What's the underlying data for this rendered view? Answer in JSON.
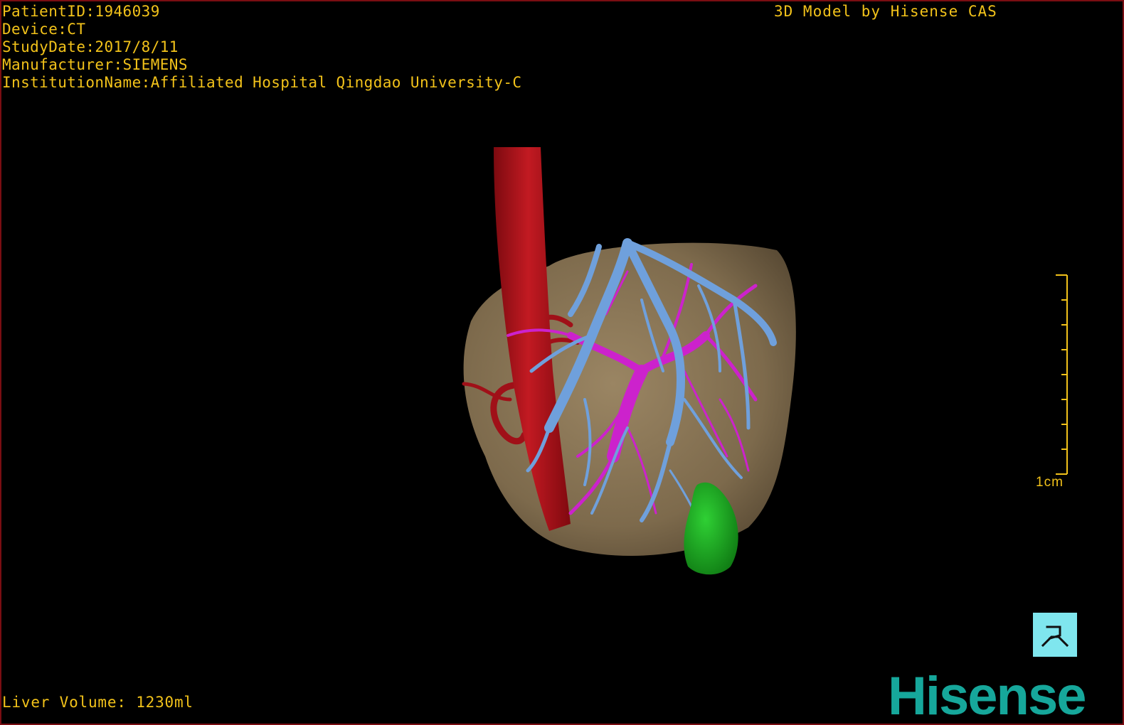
{
  "patient": {
    "id_line": "PatientID:1946039",
    "device_line": "Device:CT",
    "study_date_line": "StudyDate:2017/8/11",
    "manufacturer_line": "Manufacturer:SIEMENS",
    "institution_line": "InstitutionName:Affiliated Hospital Qingdao University-C"
  },
  "credit": "3D Model by Hisense CAS",
  "scale": {
    "label": "1cm"
  },
  "measurement": {
    "liver_volume_line": "Liver Volume: 1230ml"
  },
  "brand": {
    "logo_text": "Hisense"
  },
  "orientation_cube": {
    "glyph": "R"
  },
  "colors": {
    "text": "#f2c21a",
    "liver": "#8a7556",
    "artery": "#b8141b",
    "portal_vein": "#cc22cc",
    "hepatic_vein": "#6fa0dc",
    "gallbladder": "#1aa51f",
    "logo": "#16a79b",
    "cube": "#7fe6ee"
  }
}
